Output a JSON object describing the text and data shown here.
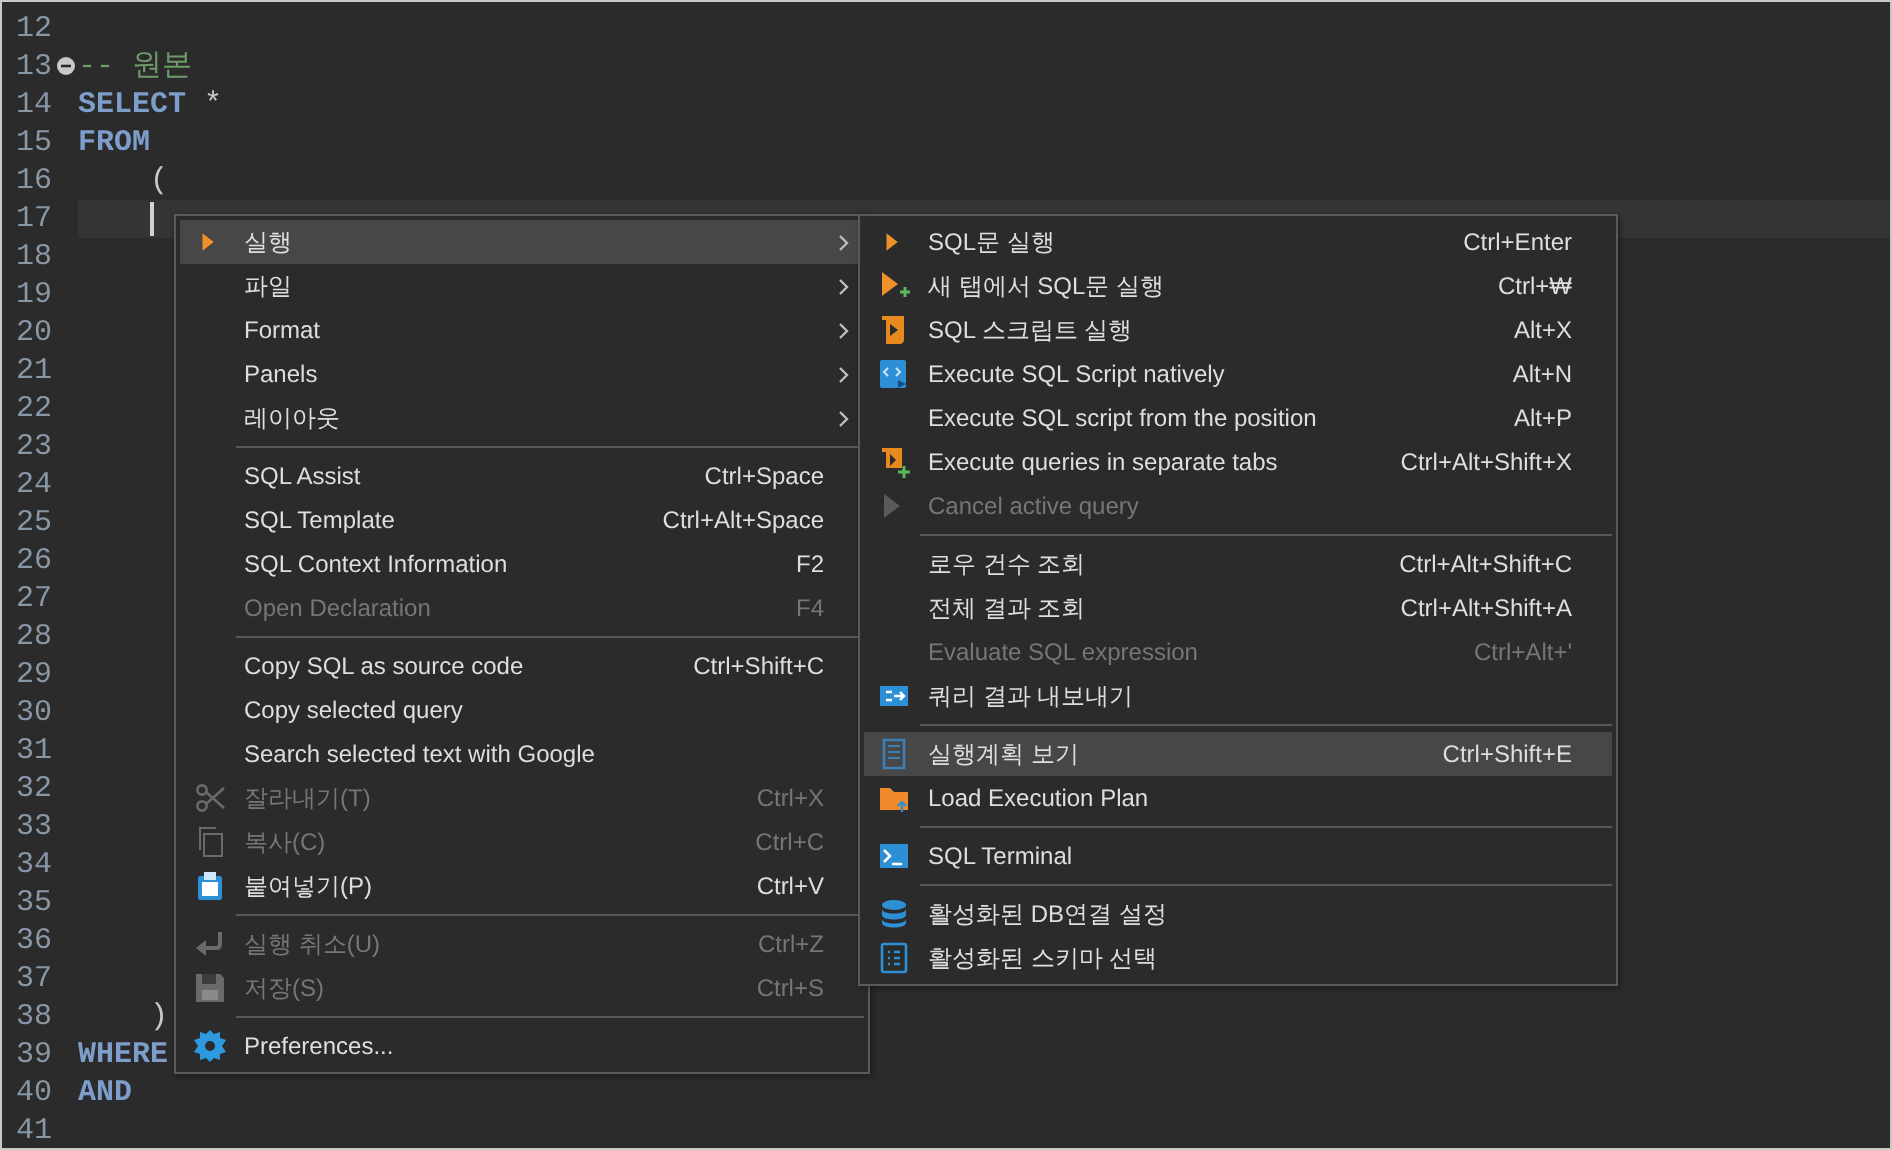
{
  "editor": {
    "lines": [
      {
        "number": "12"
      },
      {
        "number": "13",
        "fold": true,
        "tokens": [
          {
            "kind": "comment",
            "text": "-- 원본"
          }
        ]
      },
      {
        "number": "14",
        "tokens": [
          {
            "kind": "keyword",
            "text": "SELECT"
          },
          {
            "kind": "plain",
            "text": " *"
          }
        ]
      },
      {
        "number": "15",
        "tokens": [
          {
            "kind": "keyword",
            "text": "FROM"
          }
        ]
      },
      {
        "number": "16",
        "tokens": [
          {
            "kind": "plain",
            "text": "    ("
          }
        ]
      },
      {
        "number": "17",
        "current": true
      },
      {
        "number": "18"
      },
      {
        "number": "19"
      },
      {
        "number": "20"
      },
      {
        "number": "21"
      },
      {
        "number": "22"
      },
      {
        "number": "23"
      },
      {
        "number": "24"
      },
      {
        "number": "25"
      },
      {
        "number": "26"
      },
      {
        "number": "27"
      },
      {
        "number": "28"
      },
      {
        "number": "29"
      },
      {
        "number": "30"
      },
      {
        "number": "31"
      },
      {
        "number": "32"
      },
      {
        "number": "33"
      },
      {
        "number": "34"
      },
      {
        "number": "35"
      },
      {
        "number": "36"
      },
      {
        "number": "37"
      },
      {
        "number": "38",
        "tokens": [
          {
            "kind": "plain",
            "text": "    )"
          }
        ]
      },
      {
        "number": "39",
        "tokens": [
          {
            "kind": "keyword",
            "text": "WHERE"
          }
        ]
      },
      {
        "number": "40",
        "tokens": [
          {
            "kind": "keyword",
            "text": "AND"
          }
        ]
      },
      {
        "number": "41"
      }
    ]
  },
  "menus": [
    {
      "items": [
        {
          "kind": "item",
          "label": "실행",
          "submenu": true,
          "selected": true
        },
        {
          "kind": "item",
          "label": "파일",
          "submenu": true,
          "selected": false
        },
        {
          "kind": "item",
          "label": "Format",
          "submenu": true,
          "selected": false
        },
        {
          "kind": "item",
          "label": "Panels",
          "submenu": true,
          "selected": false
        },
        {
          "kind": "item",
          "label": "레이아웃",
          "submenu": true,
          "selected": false
        },
        {
          "kind": "separator"
        },
        {
          "kind": "item",
          "label": "SQL Assist",
          "shortcut": "Ctrl+Space",
          "selected": false
        },
        {
          "kind": "item",
          "label": "SQL Template",
          "shortcut": "Ctrl+Alt+Space",
          "selected": false
        },
        {
          "kind": "item",
          "label": "SQL Context Information",
          "shortcut": "F2",
          "selected": false
        },
        {
          "kind": "item",
          "label": "Open Declaration",
          "shortcut": "F4",
          "disabled": true,
          "selected": false
        },
        {
          "kind": "separator"
        },
        {
          "kind": "item",
          "label": "Copy SQL as source code",
          "shortcut": "Ctrl+Shift+C",
          "selected": false
        },
        {
          "kind": "item",
          "label": "Copy selected query",
          "selected": false
        },
        {
          "kind": "item",
          "label": "Search selected text with Google",
          "selected": false
        },
        {
          "kind": "item",
          "label": "잘라내기(T)",
          "shortcut": "Ctrl+X",
          "disabled": true,
          "selected": false
        },
        {
          "kind": "item",
          "label": "복사(C)",
          "shortcut": "Ctrl+C",
          "disabled": true,
          "selected": false
        },
        {
          "kind": "item",
          "label": "붙여넣기(P)",
          "shortcut": "Ctrl+V",
          "selected": false
        },
        {
          "kind": "separator"
        },
        {
          "kind": "item",
          "label": "실행 취소(U)",
          "shortcut": "Ctrl+Z",
          "disabled": true,
          "selected": false
        },
        {
          "kind": "item",
          "label": "저장(S)",
          "shortcut": "Ctrl+S",
          "disabled": true,
          "selected": false
        },
        {
          "kind": "separator"
        },
        {
          "kind": "item",
          "label": "Preferences...",
          "selected": false
        }
      ]
    },
    {
      "items": [
        {
          "kind": "item",
          "label": "SQL문 실행",
          "shortcut": "Ctrl+Enter",
          "selected": false
        },
        {
          "kind": "item",
          "label": "새 탭에서 SQL문 실행",
          "shortcut": "Ctrl+₩",
          "selected": false
        },
        {
          "kind": "item",
          "label": "SQL 스크립트 실행",
          "shortcut": "Alt+X",
          "selected": false
        },
        {
          "kind": "item",
          "label": "Execute SQL Script natively",
          "shortcut": "Alt+N",
          "selected": false
        },
        {
          "kind": "item",
          "label": "Execute SQL script from the position",
          "shortcut": "Alt+P",
          "selected": false
        },
        {
          "kind": "item",
          "label": "Execute queries in separate tabs",
          "shortcut": "Ctrl+Alt+Shift+X",
          "selected": false
        },
        {
          "kind": "item",
          "label": "Cancel active query",
          "disabled": true,
          "selected": false
        },
        {
          "kind": "separator"
        },
        {
          "kind": "item",
          "label": "로우 건수 조회",
          "shortcut": "Ctrl+Alt+Shift+C",
          "selected": false
        },
        {
          "kind": "item",
          "label": "전체 결과 조회",
          "shortcut": "Ctrl+Alt+Shift+A",
          "selected": false
        },
        {
          "kind": "item",
          "label": "Evaluate SQL expression",
          "shortcut": "Ctrl+Alt+'",
          "disabled": true,
          "selected": false
        },
        {
          "kind": "item",
          "label": "쿼리 결과 내보내기",
          "selected": false
        },
        {
          "kind": "separator"
        },
        {
          "kind": "item",
          "label": "실행계획 보기",
          "shortcut": "Ctrl+Shift+E",
          "selected": true
        },
        {
          "kind": "item",
          "label": "Load Execution Plan",
          "selected": false
        },
        {
          "kind": "separator"
        },
        {
          "kind": "item",
          "label": "SQL Terminal",
          "selected": false
        },
        {
          "kind": "separator"
        },
        {
          "kind": "item",
          "label": "활성화된 DB연결 설정",
          "selected": false
        },
        {
          "kind": "item",
          "label": "활성화된 스키마 선택",
          "selected": false
        }
      ]
    }
  ]
}
